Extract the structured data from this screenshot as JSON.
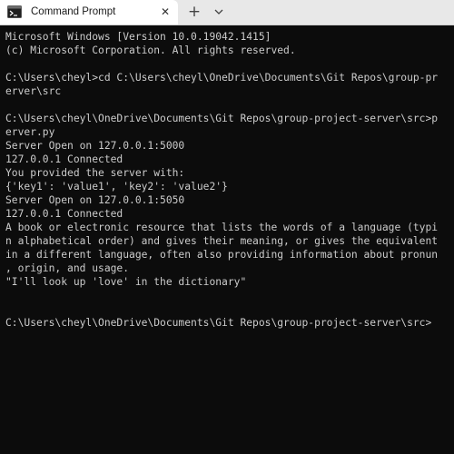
{
  "window": {
    "tab_title": "Command Prompt",
    "close_glyph": "✕",
    "new_tab_glyph": "+",
    "tab_icon": "cmd-icon",
    "dropdown_icon": "chevron-down-icon"
  },
  "terminal": {
    "lines": [
      "Microsoft Windows [Version 10.0.19042.1415]",
      "(c) Microsoft Corporation. All rights reserved.",
      "",
      "C:\\Users\\cheyl>cd C:\\Users\\cheyl\\OneDrive\\Documents\\Git Repos\\group-pr",
      "erver\\src",
      "",
      "C:\\Users\\cheyl\\OneDrive\\Documents\\Git Repos\\group-project-server\\src>p",
      "erver.py",
      "Server Open on 127.0.0.1:5000",
      "127.0.0.1 Connected",
      "You provided the server with:",
      "{'key1': 'value1', 'key2': 'value2'}",
      "Server Open on 127.0.0.1:5050",
      "127.0.0.1 Connected",
      "A book or electronic resource that lists the words of a language (typi",
      "n alphabetical order) and gives their meaning, or gives the equivalent",
      "in a different language, often also providing information about pronun",
      ", origin, and usage.",
      "\"I'll look up 'love' in the dictionary\"",
      "",
      "",
      "C:\\Users\\cheyl\\OneDrive\\Documents\\Git Repos\\group-project-server\\src>"
    ]
  },
  "colors": {
    "background": "#0c0c0c",
    "text": "#cccccc",
    "tabbar": "#e8e8e8",
    "active_tab": "#ffffff"
  }
}
